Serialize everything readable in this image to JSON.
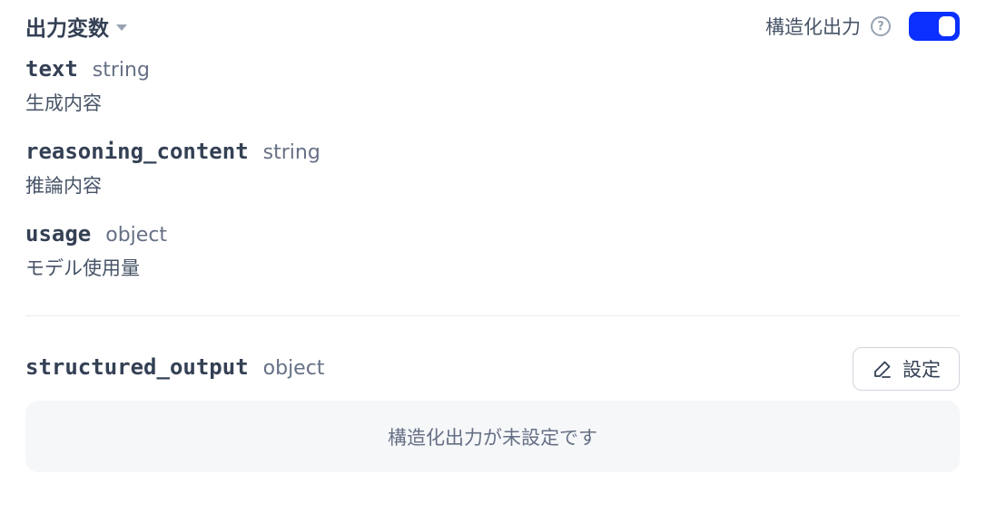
{
  "header": {
    "title": "出力変数",
    "structured_output_label": "構造化出力",
    "help_icon": "question-circle-icon",
    "toggle_on": true,
    "accent_color": "#0a2fff"
  },
  "variables": [
    {
      "name": "text",
      "type": "string",
      "description": "生成内容"
    },
    {
      "name": "reasoning_content",
      "type": "string",
      "description": "推論内容"
    },
    {
      "name": "usage",
      "type": "object",
      "description": "モデル使用量"
    }
  ],
  "structured_output": {
    "name": "structured_output",
    "type": "object",
    "settings_label": "設定",
    "settings_icon": "pencil-edit-icon",
    "empty_text": "構造化出力が未設定です"
  }
}
